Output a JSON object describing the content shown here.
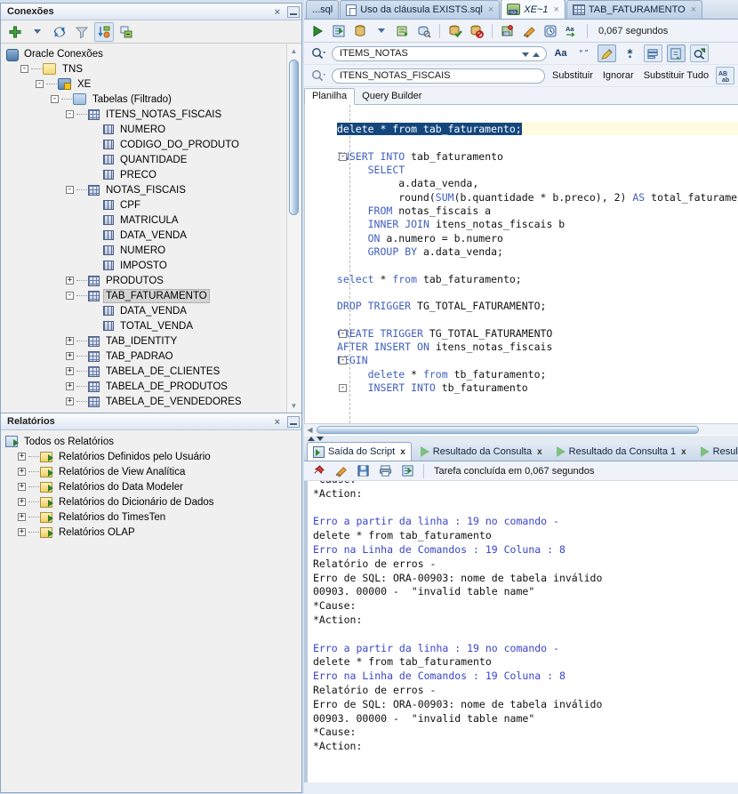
{
  "connections_panel": {
    "title": "Conexões",
    "close_label": "×",
    "toolbar": [
      {
        "name": "new-connection-icon",
        "label": "+"
      },
      {
        "name": "new-connection-dropdown-icon",
        "label": "▾"
      },
      {
        "name": "refresh-icon",
        "label": "refresh"
      },
      {
        "name": "filter-icon",
        "label": "filter"
      },
      {
        "name": "sort-icon",
        "label": "sort"
      },
      {
        "name": "collapse-all-icon",
        "label": "collapse"
      }
    ],
    "tree": [
      {
        "label": "Oracle Conexões",
        "depth": 0,
        "icon": "db",
        "expander": "none"
      },
      {
        "label": "TNS",
        "depth": 1,
        "icon": "folder",
        "expander": "-"
      },
      {
        "label": "XE",
        "depth": 2,
        "icon": "xe",
        "expander": "-"
      },
      {
        "label": "Tabelas (Filtrado)",
        "depth": 3,
        "icon": "folder-filter",
        "expander": "-"
      },
      {
        "label": "ITENS_NOTAS_FISCAIS",
        "depth": 4,
        "icon": "table",
        "expander": "-"
      },
      {
        "label": "NUMERO",
        "depth": 5,
        "icon": "column",
        "expander": "none"
      },
      {
        "label": "CODIGO_DO_PRODUTO",
        "depth": 5,
        "icon": "column",
        "expander": "none"
      },
      {
        "label": "QUANTIDADE",
        "depth": 5,
        "icon": "column",
        "expander": "none"
      },
      {
        "label": "PRECO",
        "depth": 5,
        "icon": "column",
        "expander": "none"
      },
      {
        "label": "NOTAS_FISCAIS",
        "depth": 4,
        "icon": "table",
        "expander": "-"
      },
      {
        "label": "CPF",
        "depth": 5,
        "icon": "column",
        "expander": "none"
      },
      {
        "label": "MATRICULA",
        "depth": 5,
        "icon": "column",
        "expander": "none"
      },
      {
        "label": "DATA_VENDA",
        "depth": 5,
        "icon": "column",
        "expander": "none"
      },
      {
        "label": "NUMERO",
        "depth": 5,
        "icon": "column",
        "expander": "none"
      },
      {
        "label": "IMPOSTO",
        "depth": 5,
        "icon": "column",
        "expander": "none"
      },
      {
        "label": "PRODUTOS",
        "depth": 4,
        "icon": "table",
        "expander": "+"
      },
      {
        "label": "TAB_FATURAMENTO",
        "depth": 4,
        "icon": "table",
        "expander": "-",
        "selected": true
      },
      {
        "label": "DATA_VENDA",
        "depth": 5,
        "icon": "column",
        "expander": "none"
      },
      {
        "label": "TOTAL_VENDA",
        "depth": 5,
        "icon": "column",
        "expander": "none"
      },
      {
        "label": "TAB_IDENTITY",
        "depth": 4,
        "icon": "table",
        "expander": "+"
      },
      {
        "label": "TAB_PADRAO",
        "depth": 4,
        "icon": "table",
        "expander": "+"
      },
      {
        "label": "TABELA_DE_CLIENTES",
        "depth": 4,
        "icon": "table",
        "expander": "+"
      },
      {
        "label": "TABELA_DE_PRODUTOS",
        "depth": 4,
        "icon": "table",
        "expander": "+"
      },
      {
        "label": "TABELA_DE_VENDEDORES",
        "depth": 4,
        "icon": "table",
        "expander": "+"
      }
    ]
  },
  "reports_panel": {
    "title": "Relatórios",
    "close_label": "×",
    "tree": [
      {
        "label": "Todos os Relatórios",
        "depth": 0,
        "icon": "all-reports",
        "expander": "none"
      },
      {
        "label": "Relatórios Definidos pelo Usuário",
        "depth": 1,
        "icon": "report",
        "expander": "+"
      },
      {
        "label": "Relatórios de View Analítica",
        "depth": 1,
        "icon": "report",
        "expander": "+"
      },
      {
        "label": "Relatórios do Data Modeler",
        "depth": 1,
        "icon": "report",
        "expander": "+"
      },
      {
        "label": "Relatórios do Dicionário de Dados",
        "depth": 1,
        "icon": "report",
        "expander": "+"
      },
      {
        "label": "Relatórios do TimesTen",
        "depth": 1,
        "icon": "report",
        "expander": "+"
      },
      {
        "label": "Relatórios OLAP",
        "depth": 1,
        "icon": "report",
        "expander": "+"
      }
    ]
  },
  "editor_tabs": [
    {
      "label": "...sql",
      "icon": "none",
      "active": false,
      "closable": false
    },
    {
      "label": "Uso da cláusula EXISTS.sql",
      "icon": "sql-file",
      "active": false,
      "closable": true
    },
    {
      "label": "XE~1",
      "icon": "connection",
      "active": true,
      "closable": true,
      "italic": true
    },
    {
      "label": "TAB_FATURAMENTO",
      "icon": "table",
      "active": false,
      "closable": true
    }
  ],
  "sql_toolbar": {
    "buttons": [
      {
        "name": "run-statement-icon"
      },
      {
        "name": "run-script-icon"
      },
      {
        "name": "commit-icon"
      },
      {
        "name": "commit-dropdown-icon"
      },
      {
        "name": "rollback-icon"
      },
      {
        "name": "explain-plan-icon"
      },
      {
        "name": "autotrace-icon"
      },
      {
        "name": "clear-icon"
      },
      {
        "name": "sql-history-icon"
      },
      {
        "name": "eraser-icon"
      },
      {
        "name": "schedule-icon"
      },
      {
        "name": "format-icon"
      }
    ],
    "elapsed_time": "0,067 segundos"
  },
  "find_bar": {
    "find_value": "ITEMS_NOTAS",
    "replace_value": "ITENS_NOTAS_FISCAIS",
    "match_case_label": "Aa",
    "whole_word_label": "“ ”",
    "replace_label": "Substituir",
    "skip_label": "Ignorar",
    "replace_all_label": "Substituir Tudo",
    "regex_label": "AB\nab"
  },
  "worksheet_tabs": [
    {
      "label": "Planilha",
      "active": true
    },
    {
      "label": "Query Builder",
      "active": false
    }
  ],
  "sql_code_lines": [
    {
      "text": "",
      "fold": ""
    },
    {
      "text": "delete * from tab_faturamento;",
      "selected": true,
      "fold": ""
    },
    {
      "text": "",
      "fold": ""
    },
    {
      "text": "INSERT INTO tab_faturamento",
      "fold": "-",
      "kw": [
        "INSERT",
        "INTO"
      ]
    },
    {
      "text": "     SELECT",
      "fold": "",
      "kw": [
        "SELECT"
      ]
    },
    {
      "text": "          a.data_venda,",
      "fold": ""
    },
    {
      "text": "          round(SUM(b.quantidade * b.preco), 2) AS total_faturame",
      "fold": "",
      "kw": [
        "SUM",
        "AS"
      ]
    },
    {
      "text": "     FROM notas_fiscais a",
      "fold": "",
      "kw": [
        "FROM"
      ]
    },
    {
      "text": "     INNER JOIN itens_notas_fiscais b",
      "fold": "",
      "kw": [
        "INNER",
        "JOIN"
      ]
    },
    {
      "text": "     ON a.numero = b.numero",
      "fold": "",
      "kw": [
        "ON"
      ]
    },
    {
      "text": "     GROUP BY a.data_venda;",
      "fold": "",
      "kw": [
        "GROUP",
        "BY"
      ]
    },
    {
      "text": "",
      "fold": ""
    },
    {
      "text": "select * from tab_faturamento;",
      "fold": "",
      "kw": [
        "select",
        "from"
      ]
    },
    {
      "text": "",
      "fold": ""
    },
    {
      "text": "DROP TRIGGER TG_TOTAL_FATURAMENTO;",
      "fold": "",
      "kw": [
        "DROP",
        "TRIGGER"
      ]
    },
    {
      "text": "",
      "fold": ""
    },
    {
      "text": "CREATE TRIGGER TG_TOTAL_FATURAMENTO",
      "fold": "-",
      "kw": [
        "CREATE",
        "TRIGGER"
      ]
    },
    {
      "text": "AFTER INSERT ON itens_notas_fiscais",
      "fold": "",
      "kw": [
        "AFTER",
        "INSERT",
        "ON"
      ]
    },
    {
      "text": "BEGIN",
      "fold": "-",
      "kw": [
        "BEGIN"
      ]
    },
    {
      "text": "     delete * from tb_faturamento;",
      "fold": "",
      "kw": [
        "delete",
        "from"
      ]
    },
    {
      "text": "     INSERT INTO tb_faturamento",
      "fold": "-",
      "kw": [
        "INSERT",
        "INTO"
      ],
      "clipped": true
    }
  ],
  "result_tabs": [
    {
      "label": "Saída do Script",
      "icon": "script-output",
      "active": true,
      "closable": true
    },
    {
      "label": "Resultado da Consulta",
      "icon": "query-result",
      "active": false,
      "closable": true
    },
    {
      "label": "Resultado da Consulta 1",
      "icon": "query-result",
      "active": false,
      "closable": true
    },
    {
      "label": "Resulta",
      "icon": "query-result",
      "active": false,
      "closable": false
    }
  ],
  "output_toolbar": {
    "buttons": [
      {
        "name": "pin-icon"
      },
      {
        "name": "clear-output-icon"
      },
      {
        "name": "save-icon"
      },
      {
        "name": "print-icon"
      },
      {
        "name": "script-output-icon"
      }
    ],
    "status": "Tarefa concluída em 0,067 segundos"
  },
  "script_output_lines": [
    {
      "text": "*Cause:",
      "err": false,
      "clipped": true
    },
    {
      "text": "*Action:",
      "err": false
    },
    {
      "text": "",
      "err": false
    },
    {
      "text": "Erro a partir da linha : 19 no comando -",
      "err": true
    },
    {
      "text": "delete * from tab_faturamento",
      "err": false
    },
    {
      "text": "Erro na Linha de Comandos : 19 Coluna : 8",
      "err": true
    },
    {
      "text": "Relatório de erros -",
      "err": false
    },
    {
      "text": "Erro de SQL: ORA-00903: nome de tabela inválido",
      "err": false
    },
    {
      "text": "00903. 00000 -  \"invalid table name\"",
      "err": false
    },
    {
      "text": "*Cause:",
      "err": false
    },
    {
      "text": "*Action:",
      "err": false
    },
    {
      "text": "",
      "err": false
    },
    {
      "text": "Erro a partir da linha : 19 no comando -",
      "err": true
    },
    {
      "text": "delete * from tab_faturamento",
      "err": false
    },
    {
      "text": "Erro na Linha de Comandos : 19 Coluna : 8",
      "err": true
    },
    {
      "text": "Relatório de erros -",
      "err": false
    },
    {
      "text": "Erro de SQL: ORA-00903: nome de tabela inválido",
      "err": false
    },
    {
      "text": "00903. 00000 -  \"invalid table name\"",
      "err": false
    },
    {
      "text": "*Cause:",
      "err": false
    },
    {
      "text": "*Action:",
      "err": false
    }
  ],
  "colors": {
    "keyword": "#3f5fbf",
    "error_text": "#3a45c8",
    "selection": "#14467e",
    "panel_border": "#8ba4c4",
    "accent": "#2e8b2e"
  }
}
